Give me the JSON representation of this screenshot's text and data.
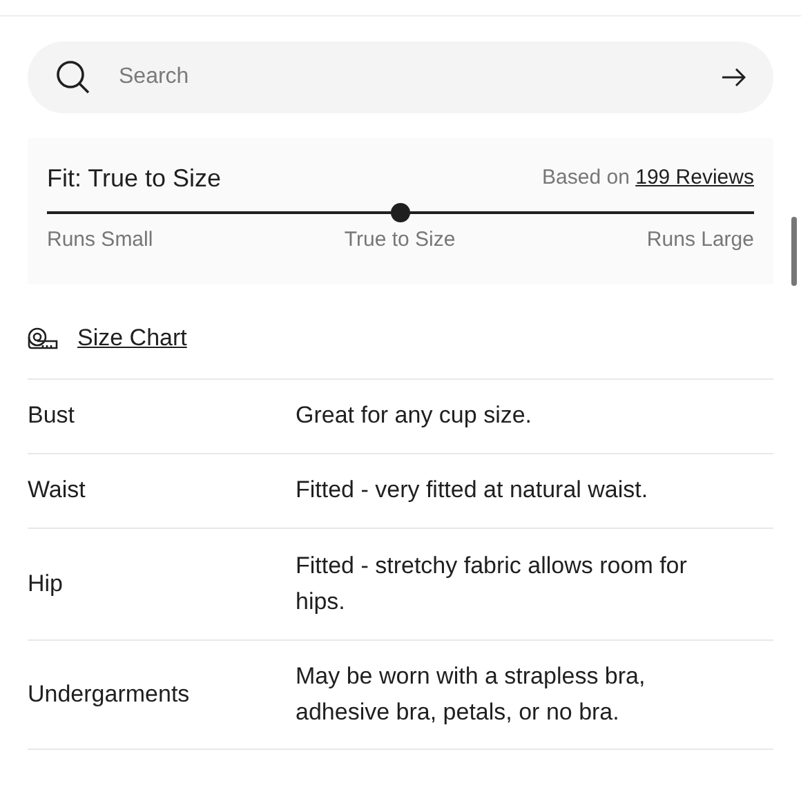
{
  "search": {
    "placeholder": "Search"
  },
  "fit": {
    "title": "Fit: True to Size",
    "based_on": "Based on",
    "reviews_link": "199 Reviews",
    "level": 0.5,
    "scale_labels": [
      "Runs Small",
      "True to Size",
      "Runs Large"
    ]
  },
  "size_chart": {
    "label": "Size Chart"
  },
  "rows": [
    {
      "label": "Bust",
      "value": "Great for any cup size."
    },
    {
      "label": "Waist",
      "value": "Fitted - very fitted at natural waist."
    },
    {
      "label": "Hip",
      "value": "Fitted - stretchy fabric allows room for hips."
    },
    {
      "label": "Undergarments",
      "value": "May be worn with a strapless bra, adhesive bra, petals, or no bra."
    }
  ]
}
